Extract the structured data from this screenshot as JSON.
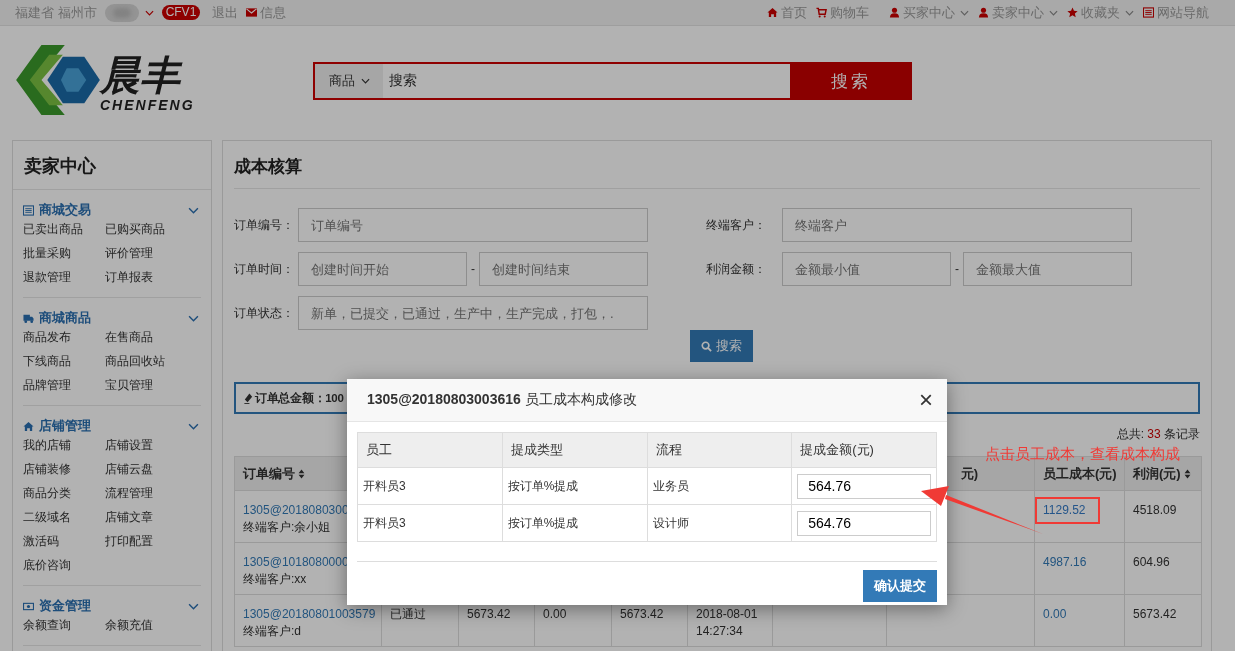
{
  "top_bar": {
    "location": "福建省 福州市",
    "badge": "CFV1",
    "logout": "退出",
    "messages": "信息",
    "nav": [
      {
        "label": "首页",
        "kind": "home",
        "dropdown": false
      },
      {
        "label": "购物车",
        "kind": "cart",
        "dropdown": false
      },
      {
        "label": "买家中心",
        "kind": "user",
        "dropdown": true
      },
      {
        "label": "卖家中心",
        "kind": "user",
        "dropdown": true
      },
      {
        "label": "收藏夹",
        "kind": "star",
        "dropdown": true
      },
      {
        "label": "网站导航",
        "kind": "list",
        "dropdown": false
      }
    ]
  },
  "header": {
    "logo": {
      "name": "晨丰",
      "sub": "CHENFENG"
    },
    "search": {
      "category": "商品",
      "value": "搜索",
      "button": "搜索"
    }
  },
  "sidebar": {
    "title": "卖家中心",
    "sections": [
      {
        "title": "商城交易",
        "kind": "list",
        "items": [
          "已卖出商品",
          "已购买商品",
          "批量采购",
          "评价管理",
          "退款管理",
          "订单报表"
        ]
      },
      {
        "title": "商城商品",
        "kind": "truck",
        "items": [
          "商品发布",
          "在售商品",
          "下线商品",
          "商品回收站",
          "品牌管理",
          "宝贝管理"
        ]
      },
      {
        "title": "店铺管理",
        "kind": "home",
        "items": [
          "我的店铺",
          "店铺设置",
          "店铺装修",
          "店铺云盘",
          "商品分类",
          "流程管理",
          "二级域名",
          "店铺文章",
          "激活码",
          "打印配置",
          "底价咨询"
        ]
      },
      {
        "title": "资金管理",
        "kind": "money",
        "items": [
          "余额查询",
          "余额充值"
        ]
      }
    ]
  },
  "main": {
    "title": "成本核算",
    "filters_left": [
      {
        "label": "订单编号：",
        "placeholders": [
          "订单编号"
        ]
      },
      {
        "label": "订单时间：",
        "placeholders": [
          "创建时间开始",
          "创建时间结束"
        ],
        "separator": "-"
      },
      {
        "label": "订单状态：",
        "placeholders": [
          "新单，已提交，已通过，生产中，生产完成，打包，."
        ]
      }
    ],
    "filters_right": [
      {
        "label": "终端客户：",
        "placeholders": [
          "终端客户"
        ]
      },
      {
        "label": "利润金额：",
        "placeholders": [
          "金额最小值",
          "金额最大值"
        ],
        "separator": "-"
      }
    ],
    "search_button": "搜索",
    "summary": "订单总金额：100",
    "total": {
      "prefix": "总共:",
      "count": "33",
      "suffix": "条记录"
    },
    "table": {
      "columns": [
        {
          "label": "订单编号",
          "sortable": true
        },
        null,
        null,
        null,
        null,
        null,
        null,
        {
          "label": "元)",
          "sortable": false
        },
        {
          "label": "员工成本(元)",
          "sortable": false
        },
        {
          "label": "利润(元)",
          "sortable": true
        }
      ],
      "rows": [
        {
          "order": "1305@2018080300",
          "customer": "终端客户:余小姐",
          "cells": [
            null,
            null,
            null,
            null,
            null,
            null,
            null
          ],
          "cost": "1129.52",
          "cost_highlighted": true,
          "profit": "4518.09"
        },
        {
          "order": "1305@1018080000",
          "customer": "终端客户:xx",
          "cells": [
            null,
            null,
            null,
            null,
            null,
            null,
            null
          ],
          "cost": "4987.16",
          "cost_highlighted": false,
          "profit": "604.96"
        },
        {
          "order": "1305@20180801003579",
          "customer": "终端客户:d",
          "cells": [
            "已通过",
            "5673.42",
            "0.00",
            "5673.42",
            "2018-08-01 14:27:34",
            null,
            null
          ],
          "cost": "0.00",
          "cost_highlighted": false,
          "profit": "5673.42"
        }
      ]
    }
  },
  "modal": {
    "title": "**1305@20180803003616** 员工成本构成修改",
    "close": "×",
    "columns": [
      "员工",
      "提成类型",
      "流程",
      "提成金额(元)"
    ],
    "rows": [
      {
        "employee": "开料员3",
        "type": "按订单%提成",
        "process": "业务员",
        "amount": "564.76"
      },
      {
        "employee": "开料员3",
        "type": "按订单%提成",
        "process": "设计师",
        "amount": "564.76"
      }
    ],
    "submit": "确认提交"
  },
  "annotation": {
    "text": "点击员工成本，查看成本构成"
  }
}
